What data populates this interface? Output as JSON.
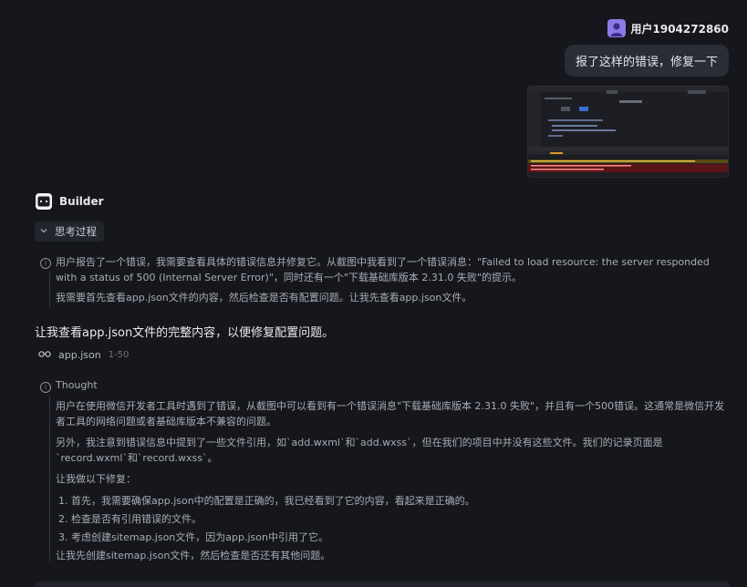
{
  "user": {
    "name": "用户1904272860",
    "message": "报了这样的错误，修复一下"
  },
  "assistant": {
    "name": "Builder",
    "thinking_label": "思考过程",
    "thinking_para1": "用户报告了一个错误，我需要查看具体的错误信息并修复它。从截图中我看到了一个错误消息：\"Failed to load resource: the server responded with a status of 500 (Internal Server Error)\"，同时还有一个\"下载基础库版本 2.31.0 失败\"的提示。",
    "thinking_para2": "我需要首先查看app.json文件的内容，然后检查是否有配置问题。让我先查看app.json文件。",
    "main_line": "让我查看app.json文件的完整内容，以便修复配置问题。",
    "file_ref": {
      "name": "app.json",
      "range": "1-50"
    },
    "thought_title": "Thought",
    "thought_para1": "用户在使用微信开发者工具时遇到了错误，从截图中可以看到有一个错误消息\"下载基础库版本 2.31.0 失败\"，并且有一个500错误。这通常是微信开发者工具的网络问题或者基础库版本不兼容的问题。",
    "thought_para2": "另外，我注意到错误信息中提到了一些文件引用，如`add.wxml`和`add.wxss`，但在我们的项目中并没有这些文件。我们的记录页面是`record.wxml`和`record.wxss`。",
    "thought_para3": "让我做以下修复：",
    "thought_list": [
      "1. 首先，我需要确保app.json中的配置是正确的，我已经看到了它的内容，看起来是正确的。",
      "2. 检查是否有引用错误的文件。",
      "3. 考虑创建sitemap.json文件，因为app.json中引用了它。"
    ],
    "thought_final": "让我先创建sitemap.json文件，然后检查是否还有其他问题。"
  },
  "colors": {
    "background": "#16171d",
    "bubble": "#2a2c36",
    "avatar": "#8b7be8",
    "error_red": "#8a1d22"
  },
  "icons": [
    "user-avatar-icon",
    "builder-logo-icon",
    "chevron-down-icon",
    "info-icon",
    "glasses-icon"
  ]
}
